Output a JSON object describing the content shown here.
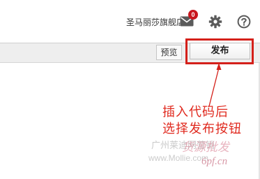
{
  "header": {
    "shop_name": "圣马丽莎旗舰店",
    "mail_badge": "0",
    "icons": [
      "mail-icon",
      "gear-icon",
      "help-icon"
    ]
  },
  "toolbar": {
    "preview_label": "预览",
    "publish_label": "发布"
  },
  "annotation": {
    "line1": "插入代码后",
    "line2": "选择发布按钮",
    "color": "#e02a1f"
  },
  "watermark": {
    "brand": "货源批发",
    "site_cn": "广州莱迪网营销",
    "site_url": "www.Mollie.com",
    "site_url2": "6pf.cn"
  }
}
